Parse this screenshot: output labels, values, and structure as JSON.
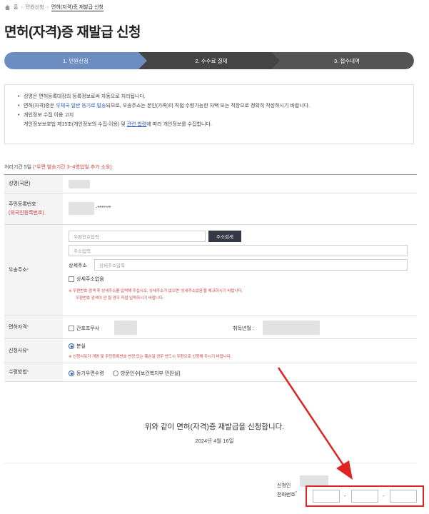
{
  "breadcrumb": {
    "home": "홈",
    "level1": "민원신청",
    "current": "면허(자격)증 재발급 신청"
  },
  "page_title": "면허(자격)증 재발급 신청",
  "steps": [
    {
      "label": "1. 민원신청",
      "active": true
    },
    {
      "label": "2. 수수료 결제",
      "active": false
    },
    {
      "label": "3. 접수내역",
      "active": false
    }
  ],
  "notice": {
    "line1": "성명은 면허등록대장의 등록정보로써 자동으로 처리됩니다.",
    "line2_a": "면허(자격)증은 ",
    "line2_blue": "우체국 일반 등기로 발송",
    "line2_b": "되므로, 우송주소는 본인(가족)이 직접 수령가능한 자택 또는 직장으로 정확히 작성하시기 바랍니다.",
    "line3": "개인정보 수집 이용 고지",
    "line4_a": "개인정보보호법 제15조(개인정보의 수집 이용) 및 ",
    "line4_link": "관련 법령",
    "line4_b": "에 따라 개인정보를 수집합니다."
  },
  "period": {
    "text": "처리기간 5일 ",
    "red": "(*우편 발송기간 3~4영업일 추가 소요)"
  },
  "form": {
    "name_label": "성명(국문)",
    "rrn_label": "주민등록번호",
    "rrn_label_sub": "(외국인등록번호)",
    "rrn_masked": "-*******",
    "address_label": "우송주소",
    "zip_placeholder": "우편번호입력",
    "address_search_btn": "주소검색",
    "address_placeholder": "주소입력",
    "detail_label": "상세주소",
    "detail_placeholder": "상세주소입력",
    "no_detail_label": "상세주소없음",
    "address_warn1": "※ 우편번호 검색 후 상세주소를 입력해 주십시오. 상세주소가 없으면 '상세주소없음'을 체크하시기 바랍니다.",
    "address_warn2": "우편번호 검색이 안 될 경우 직접 입력하시기 바랍니다.",
    "license_label": "면허자격",
    "license_option": "간호조무사",
    "acquired_label": "취득년월 :",
    "reason_label": "신청사유",
    "reason_option": "분실",
    "reason_warn": "※ 신청사유가 개명 및 주민등록번호 변경 또는 훼손일 경우 반드시 우편으로 신청해 주시기 바랍니다.",
    "receive_label": "수령방법",
    "receive_option1": "등기우편수령",
    "receive_option2": "방문인수[보건복지부 민원실]",
    "required_mark": "*"
  },
  "confirm_text": "위와 같이 면허(자격)증 재발급을 신청합니다.",
  "date_text": "2024년 4월 16일",
  "applicant_label": "신청인",
  "phone_label": "전화번호",
  "phone_sep": "-",
  "colors": {
    "accent_blue": "#6d8cc0",
    "step_dark": "#444444",
    "warning_red": "#d23c3c",
    "annotation_red": "#e02424",
    "link_blue": "#2a5bb8"
  },
  "icons": [
    "home-icon",
    "red-arrow-annotation"
  ]
}
